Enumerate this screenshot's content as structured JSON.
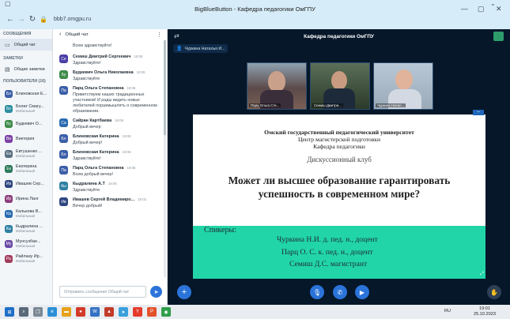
{
  "browser": {
    "url": "bbb7.omgpu.ru",
    "page_title": "BigBlueButton - Кафедра педагогики ОмГПУ"
  },
  "leftnav": {
    "messages_header": "СООБЩЕНИЯ",
    "public_chat": "Общий чат",
    "notes_header": "ЗАМЕТКИ",
    "shared_notes": "Общие заметки",
    "users_header": "ПОЛЬЗОВАТЕЛИ (16)",
    "users": [
      {
        "initials": "Бл",
        "name": "Блиновская Е...",
        "role": "",
        "color": "#3c5fa8"
      },
      {
        "initials": "Бо",
        "name": "Болат Смагу...",
        "role": "Мобильный",
        "color": "#2a8ea0"
      },
      {
        "initials": "Бу",
        "name": "Будкевич О...",
        "role": "",
        "color": "#3d8a4a"
      },
      {
        "initials": "Ви",
        "name": "Виктория",
        "role": "",
        "color": "#7b3fa6"
      },
      {
        "initials": "Ев",
        "name": "Евтушенко ...",
        "role": "Мобильный",
        "color": "#5a6f80"
      },
      {
        "initials": "Ек",
        "name": "Екатерина",
        "role": "Мобильный",
        "color": "#2b7a5c"
      },
      {
        "initials": "Ив",
        "name": "Ивашев Сер...",
        "role": "",
        "color": "#2d4680"
      },
      {
        "initials": "Ир",
        "name": "Ирина Ланг",
        "role": "",
        "color": "#8a3b7a"
      },
      {
        "initials": "Ка",
        "name": "Калькова В...",
        "role": "Мобильный",
        "color": "#2a6bb0"
      },
      {
        "initials": "Кы",
        "name": "Кыдралина ...",
        "role": "Мобильный",
        "color": "#2e7fa3"
      },
      {
        "initials": "Му",
        "name": "Мунсузбае...",
        "role": "Мобильный",
        "color": "#6b4aa6"
      },
      {
        "initials": "Ра",
        "name": "Райлану Ир...",
        "role": "Мобильный",
        "color": "#a33b5a"
      }
    ]
  },
  "chat": {
    "title": "Общий чат",
    "input_placeholder": "Отправить сообщение Общий чат",
    "messages": [
      {
        "initials": "",
        "name": "",
        "time": "",
        "text": "Всем здравствуйте!",
        "color": "#4a3fa6"
      },
      {
        "initials": "Се",
        "name": "Семиш Дмитрий Сергеевич",
        "time": "18:06",
        "text": "Здравствуйте!",
        "color": "#4a3fa6"
      },
      {
        "initials": "Бу",
        "name": "Будкевич Ольга Николаевна",
        "time": "18:06",
        "text": "Здравствуйте",
        "color": "#3d8a4a"
      },
      {
        "initials": "Па",
        "name": "Парц Ольга Степановна",
        "time": "18:06",
        "text": "Приветствуем наших традиционных участников! И рады видеть новых любителей поразмышлять о современном образовании.",
        "color": "#3c5fa8"
      },
      {
        "initials": "Са",
        "name": "Сайран Картбаева",
        "time": "18:06",
        "text": "Добрый вечер",
        "color": "#2a6bb0"
      },
      {
        "initials": "Бл",
        "name": "Блиновская Катерина",
        "time": "18:06",
        "text": "Добрый вечер!",
        "color": "#3c5fa8"
      },
      {
        "initials": "Бл",
        "name": "Блиновская Катерина",
        "time": "18:06",
        "text": "Здравствуйте!",
        "color": "#3c5fa8"
      },
      {
        "initials": "Па",
        "name": "Парц Ольга Степановна",
        "time": "18:06",
        "text": "Всем добрый вечер!",
        "color": "#3c5fa8"
      },
      {
        "initials": "Кы",
        "name": "Кыдралина А.Т",
        "time": "18:06",
        "text": "Здравствуйте",
        "color": "#2e7fa3"
      },
      {
        "initials": "Ив",
        "name": "Ивашев Сергей Владимиро...",
        "time": "18:02",
        "text": "Вечер добрый!",
        "color": "#2d4680"
      }
    ]
  },
  "main": {
    "room_title": "Кафедра педагогики ОмГПУ",
    "pinned_presenter": "Чуркина Наталья И...",
    "cams": [
      {
        "label": "Парц Ольга Сте..."
      },
      {
        "label": "Семиш Дмитри..."
      },
      {
        "label": "Чуркина Натал..."
      }
    ],
    "slide": {
      "line1": "Омский государственный педагогический университет",
      "line2": "Центр магистерской подготовки",
      "line3": "Кафедра педагогики",
      "club": "Дискуссионный клуб",
      "question_1": "Может ли высшее образование гарантировать",
      "question_2": "успешность в современном мире?",
      "speakers_label": "Спикеры:",
      "speaker_1": "Чуркина Н.И. д. пед. н., доцент",
      "speaker_2": "Парц О. С. к. пед. н., доцент",
      "speaker_3": "Семиш Д.С. магистрант"
    }
  },
  "taskbar": {
    "lang": "RU",
    "time": "19:01",
    "date": "25.10.2023"
  }
}
